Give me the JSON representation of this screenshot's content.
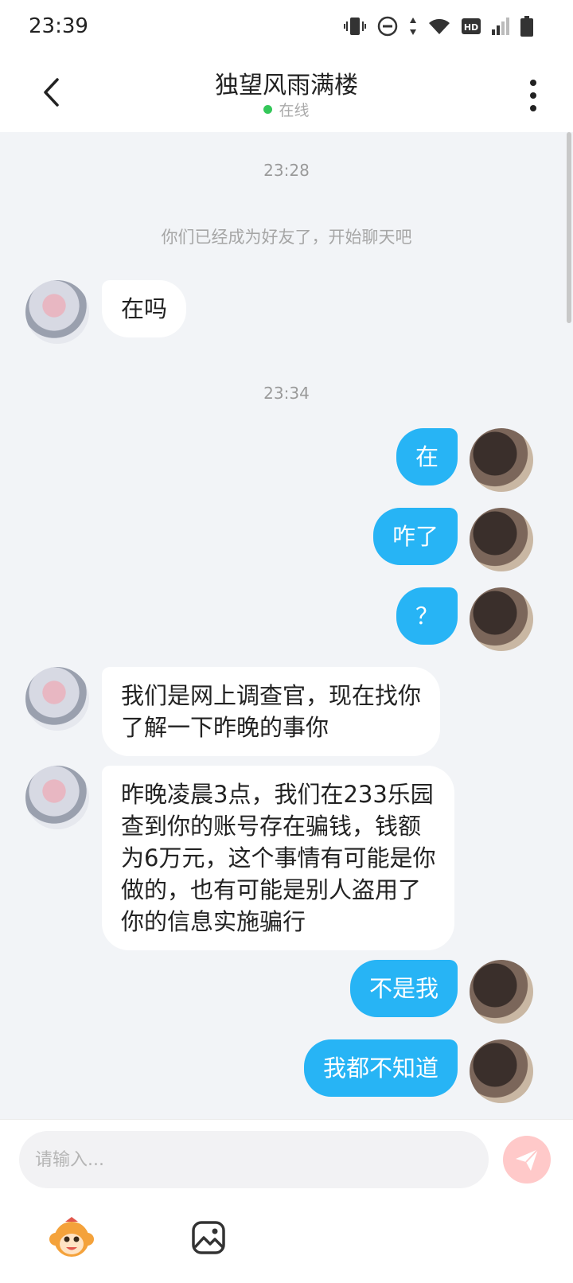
{
  "status_bar": {
    "time": "23:39",
    "icons": [
      "vibrate-icon",
      "do-not-disturb-icon",
      "data-arrows-icon",
      "wifi-icon",
      "hd-icon",
      "signal-icon",
      "battery-icon"
    ],
    "hd_label": "HD"
  },
  "header": {
    "title": "独望风雨满楼",
    "status": "在线"
  },
  "chat": {
    "timestamps": [
      "23:28",
      "23:34"
    ],
    "system_message": "你们已经成为好友了，开始聊天吧",
    "messages": [
      {
        "side": "left",
        "lines": [
          "在吗"
        ]
      },
      {
        "side": "right",
        "lines": [
          "在"
        ]
      },
      {
        "side": "right",
        "lines": [
          "咋了"
        ]
      },
      {
        "side": "right",
        "lines": [
          "？"
        ]
      },
      {
        "side": "left",
        "lines": [
          "我们是网上调查官，现在找你",
          "了解一下昨晚的事你"
        ]
      },
      {
        "side": "left",
        "lines": [
          "昨晚凌晨3点，我们在233乐园",
          "查到你的账号存在骗钱，钱额",
          "为6万元，这个事情有可能是你",
          "做的，也有可能是别人盗用了",
          "你的信息实施骗行"
        ]
      },
      {
        "side": "right",
        "lines": [
          "不是我"
        ]
      },
      {
        "side": "right",
        "lines": [
          "我都不知道"
        ]
      }
    ]
  },
  "input": {
    "placeholder": "请输入..."
  },
  "colors": {
    "outgoing_bubble": "#27b4f5",
    "incoming_bubble": "#ffffff",
    "background": "#f2f4f7",
    "online": "#34c759",
    "send_button": "#ffc9c9"
  }
}
